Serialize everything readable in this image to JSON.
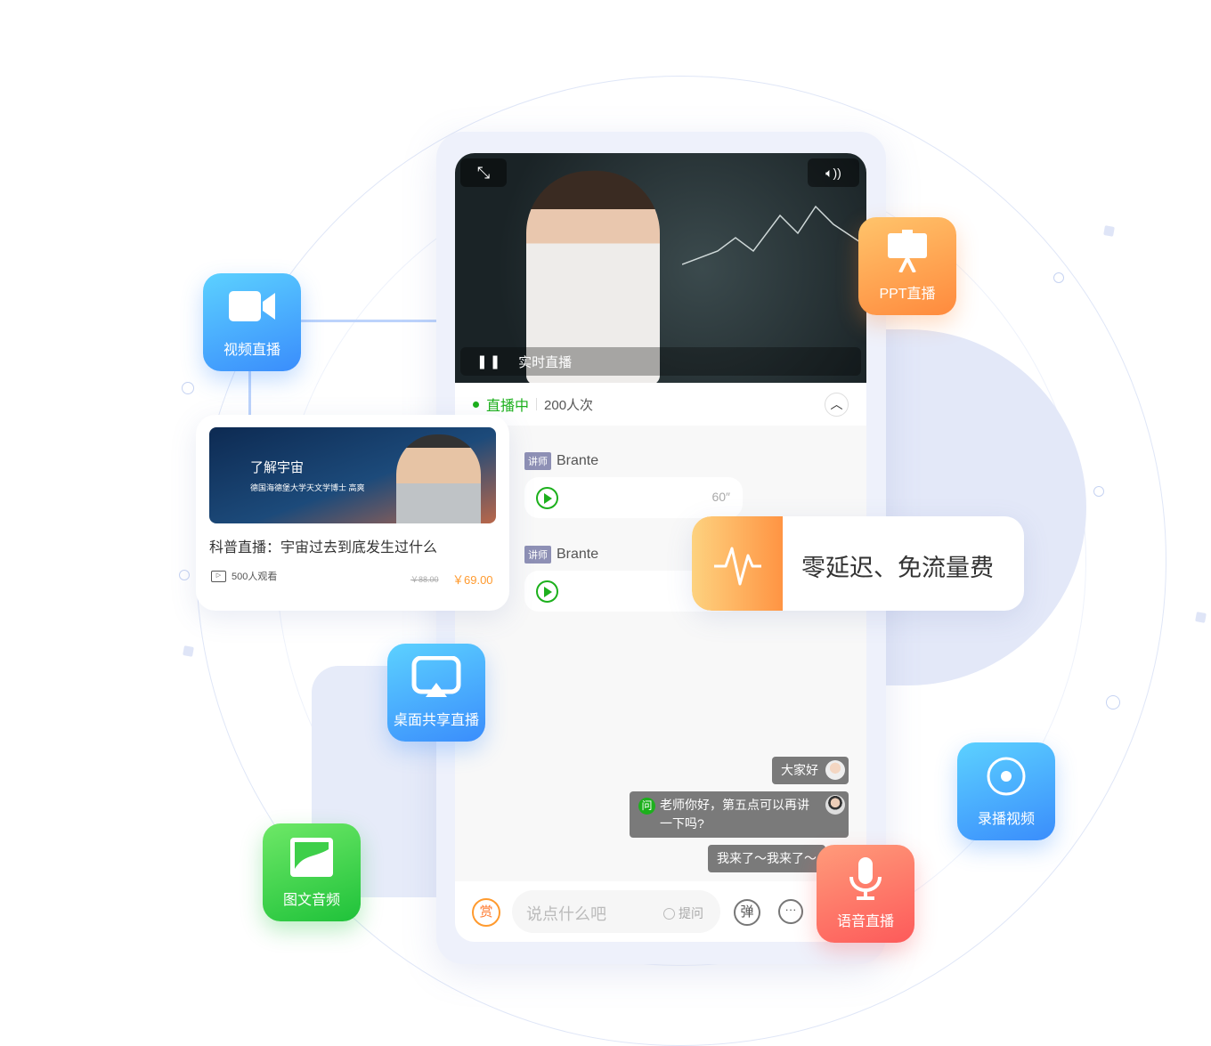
{
  "tiles": {
    "video_live": "视频直播",
    "ppt_live": "PPT直播",
    "desktop_share": "桌面共享直播",
    "image_audio": "图文音频",
    "recorded_video": "录播视频",
    "voice_live": "语音直播"
  },
  "player": {
    "live_label": "实时直播",
    "status": "直播中",
    "viewers": "200人次"
  },
  "chat": {
    "teacher_tag": "讲师",
    "teacher_name": "Brante",
    "voice_duration": "60″",
    "messages": [
      {
        "text": "大家好"
      },
      {
        "badge": "问",
        "text": "老师你好，第五点可以再讲一下吗?"
      },
      {
        "text": "我来了～我来了～"
      }
    ]
  },
  "input": {
    "reward": "赏",
    "placeholder": "说点什么吧",
    "ask_label": "提问",
    "danmu": "弹"
  },
  "course": {
    "banner_title": "了解宇宙",
    "banner_subtitle": "德国海德堡大学天文学博士  高爽",
    "title": "科普直播：宇宙过去到底发生过什么",
    "views": "500人观看",
    "original_price": "￥88.00",
    "price": "￥69.00"
  },
  "feature": {
    "text": "零延迟、免流量费"
  },
  "colors": {
    "green": "#1cb01c",
    "orange": "#ff9a2e",
    "blue": "#3a9bff"
  }
}
